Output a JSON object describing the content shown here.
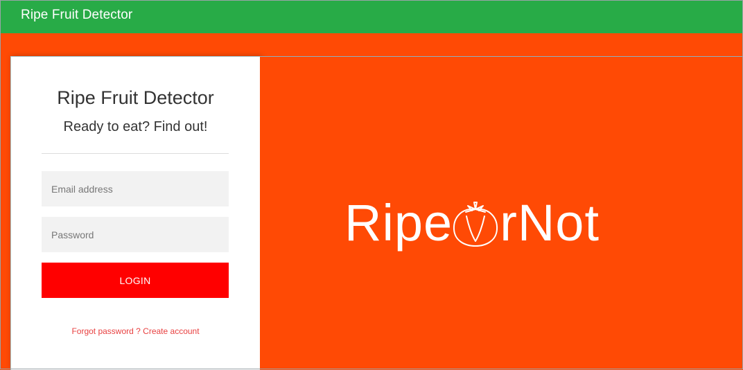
{
  "navbar": {
    "title": "Ripe Fruit Detector"
  },
  "login_panel": {
    "title": "Ripe Fruit Detector",
    "subtitle": "Ready to eat? Find out!",
    "email_placeholder": "Email address",
    "password_placeholder": "Password",
    "login_label": "LOGIN",
    "forgot_link": "Forgot password ?",
    "create_link": "Create account"
  },
  "hero": {
    "logo_before": "Ripe",
    "logo_after": "rNot",
    "logo_icon": "tomato-icon"
  },
  "colors": {
    "navbar": "#28ab47",
    "background": "#ff4a05",
    "login_button": "#ff0000",
    "link": "#e84040"
  }
}
